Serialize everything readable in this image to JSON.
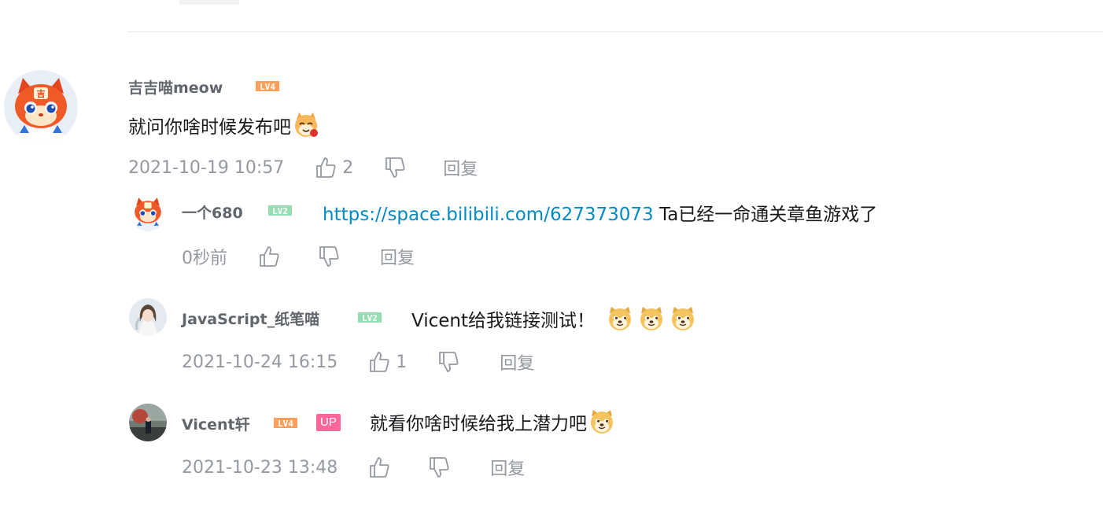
{
  "colors": {
    "username": "#61666d",
    "content": "#18191c",
    "meta": "#9499a0",
    "link": "#008ac5",
    "divider": "#e3e5e7",
    "up_badge": "#ff6699",
    "lv4": "#ff9f5a",
    "lv2": "#95ddb2"
  },
  "main_comment": {
    "username": "吉吉喵meow",
    "level": "LV4",
    "text": "就问你啥时候发布吧",
    "emoji": "cat-emoji-icon",
    "time": "2021-10-19 10:57",
    "likes": "2",
    "reply_label": "回复"
  },
  "replies": [
    {
      "username": "一个680",
      "level": "LV2",
      "link": "https://space.bilibili.com/627373073",
      "text": " Ta已经一命通关章鱼游戏了",
      "time": "0秒前",
      "likes": "",
      "reply_label": "回复"
    },
    {
      "username": "JavaScript_纸笔喵",
      "level": "LV2",
      "text": "Vicent给我链接测试！",
      "emojis": [
        "doge-emoji-icon",
        "doge-emoji-icon",
        "doge-emoji-icon"
      ],
      "time": "2021-10-24 16:15",
      "likes": "1",
      "reply_label": "回复"
    },
    {
      "username": "Vicent轩",
      "level": "LV4",
      "badge": "UP",
      "text": "就看你啥时候给我上潜力吧",
      "emoji": "doge-emoji-icon",
      "time": "2021-10-23 13:48",
      "likes": "",
      "reply_label": "回复"
    }
  ]
}
